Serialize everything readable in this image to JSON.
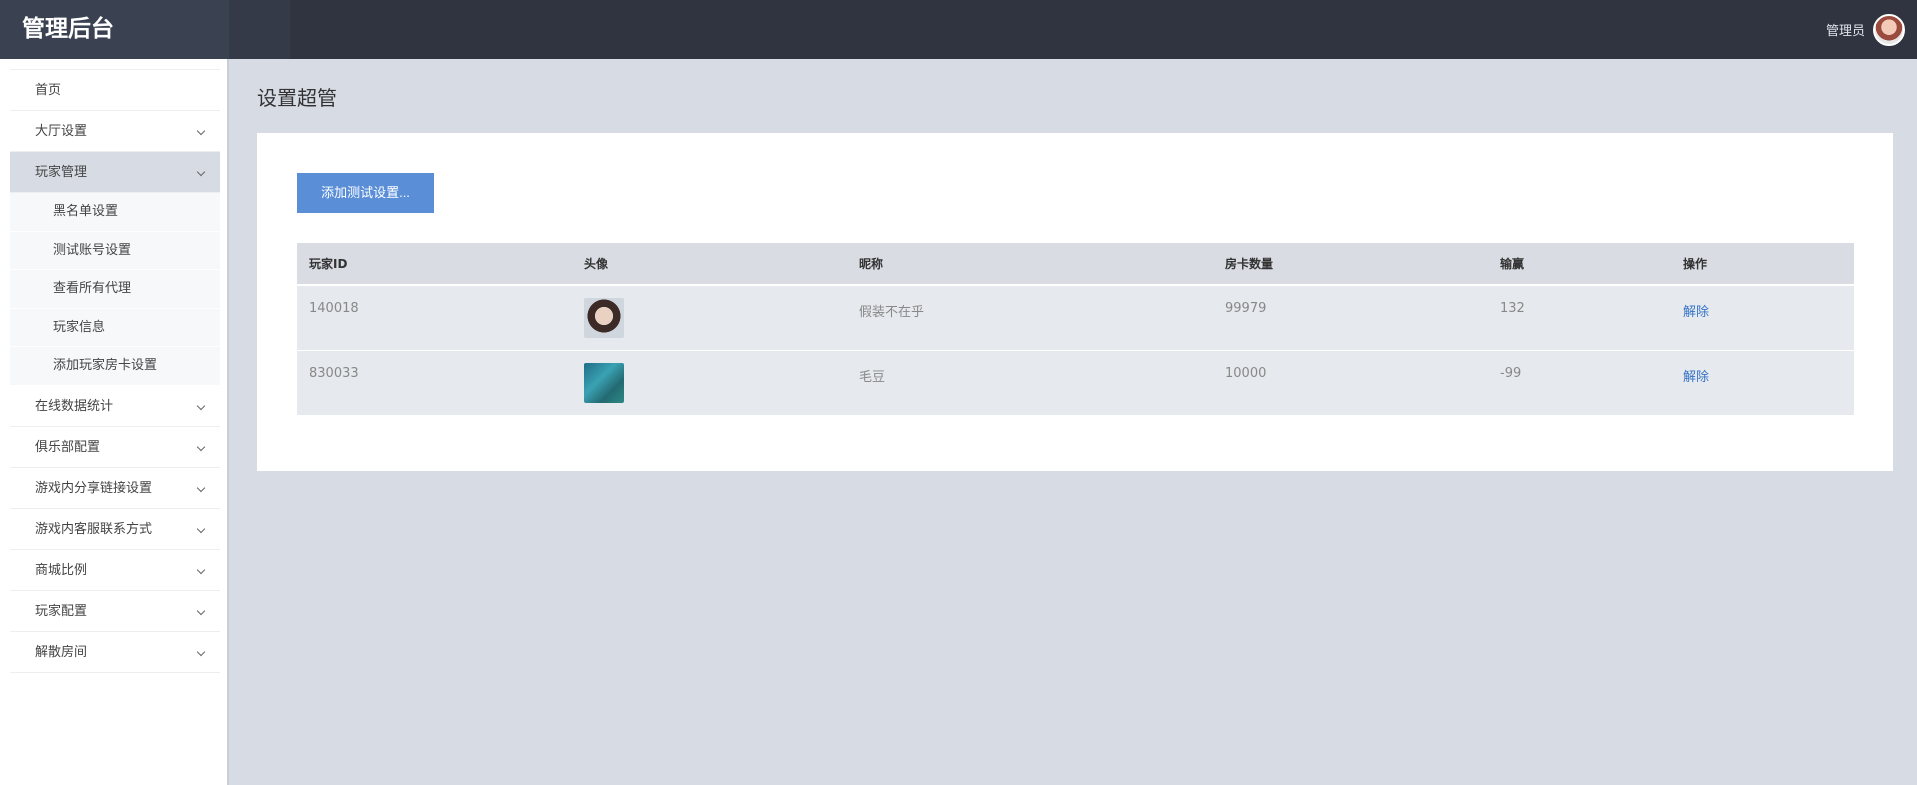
{
  "header": {
    "brand": "管理后台",
    "user_name": "管理员"
  },
  "sidebar": {
    "items": [
      {
        "label": "首页"
      },
      {
        "label": "大厅设置"
      },
      {
        "label": "玩家管理"
      },
      {
        "label": "在线数据统计"
      },
      {
        "label": "俱乐部配置"
      },
      {
        "label": "游戏内分享链接设置"
      },
      {
        "label": "游戏内客服联系方式"
      },
      {
        "label": "商城比例"
      },
      {
        "label": "玩家配置"
      },
      {
        "label": "解散房间"
      }
    ],
    "submenu": [
      {
        "label": "黑名单设置"
      },
      {
        "label": "测试账号设置"
      },
      {
        "label": "查看所有代理"
      },
      {
        "label": "玩家信息"
      },
      {
        "label": "添加玩家房卡设置"
      }
    ]
  },
  "main": {
    "title": "设置超管",
    "add_button": "添加测试设置...",
    "table": {
      "headers": [
        "玩家ID",
        "头像",
        "昵称",
        "房卡数量",
        "输赢",
        "操作"
      ],
      "rows": [
        {
          "id": "140018",
          "nickname": "假装不在乎",
          "cards": "99979",
          "win_loss": "132",
          "action": "解除"
        },
        {
          "id": "830033",
          "nickname": "毛豆",
          "cards": "10000",
          "win_loss": "-99",
          "action": "解除"
        }
      ]
    }
  }
}
